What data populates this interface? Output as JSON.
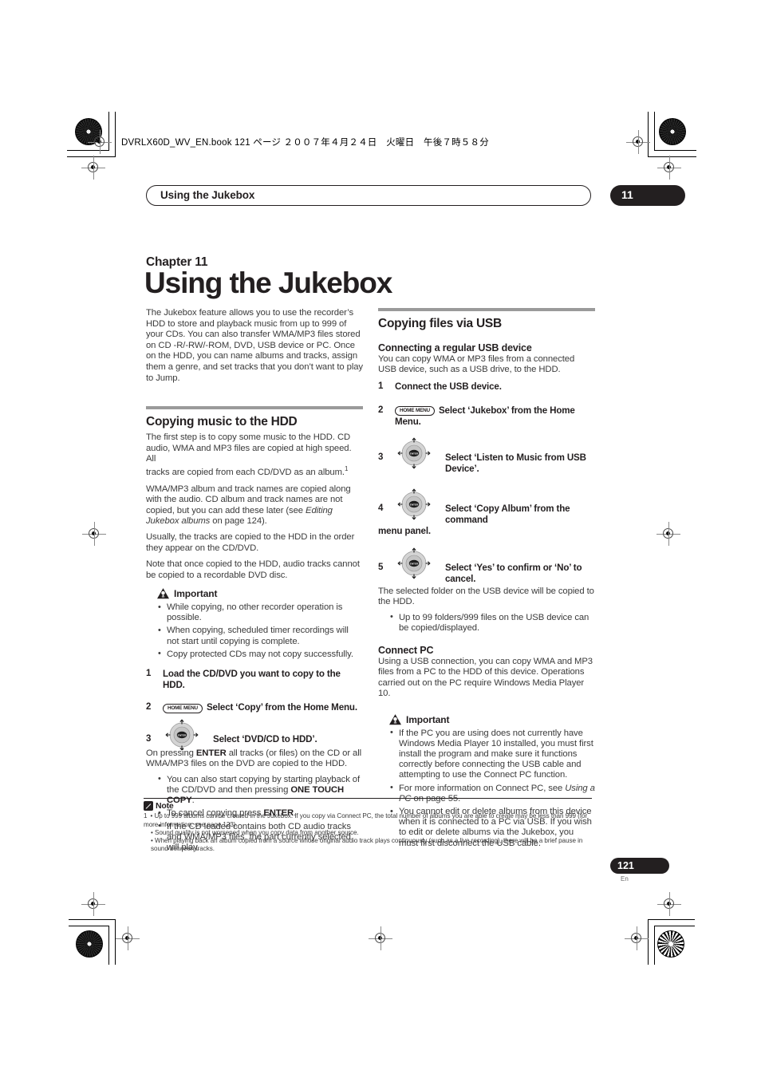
{
  "print_marks": {
    "book_line": "DVRLX60D_WV_EN.book  121 ページ  ２００７年４月２４日　火曜日　午後７時５８分"
  },
  "running_head": {
    "title": "Using the Jukebox",
    "chapter_tab": "11"
  },
  "title_block": {
    "chapter_label": "Chapter 11",
    "chapter_title": "Using the Jukebox",
    "intro": "The Jukebox feature allows you to use the recorder’s HDD to store and playback music from up to 999 of your CDs. You can also transfer WMA/MP3 files stored on CD -R/-RW/-ROM, DVD, USB device or PC. Once on the HDD, you can name albums and tracks, assign them a genre, and set tracks that you don’t want to play to Jump."
  },
  "left_column": {
    "section_heading": "Copying music to the HDD",
    "para_1a": "The first step is to copy some music to the HDD. CD audio, WMA and MP3 files are copied at high speed. All",
    "para_1b": "tracks are copied from each CD/DVD as an album.",
    "footnote_marker": "1",
    "para_2_pre": "WMA/MP3 album and track names are copied along with the audio. CD album and track names are not copied, but you can add these later (see ",
    "para_2_italic": "Editing Jukebox albums",
    "para_2_post": " on page 124).",
    "para_3": "Usually, the tracks are copied to the HDD in the order they appear on the CD/DVD.",
    "para_4": "Note that once copied to the HDD, audio tracks cannot be copied to a recordable DVD disc.",
    "important_label": "Important",
    "important_bullets": [
      "While copying, no other recorder operation is possible.",
      "When copying, scheduled timer recordings will not start until copying is complete.",
      "Copy protected CDs may not copy successfully."
    ],
    "steps": [
      {
        "num": "1",
        "text": "Load the CD/DVD you want to copy to the HDD.",
        "icon": "none"
      },
      {
        "num": "2",
        "button_label": "HOME MENU",
        "text": "Select ‘Copy’ from the Home Menu.",
        "icon": "home-menu-button"
      },
      {
        "num": "3",
        "text": "Select ‘DVD/CD to HDD’.",
        "icon": "navigation-wheel"
      }
    ],
    "step3_body_pre": "On pressing ",
    "step3_body_bold": "ENTER",
    "step3_body_post": " all tracks (or files) on the CD or all WMA/MP3 files on the DVD are copied to the HDD.",
    "step3_bullets": [
      {
        "pre": "You can also start copying by starting playback of the CD/DVD and then pressing ",
        "bold": "ONE TOUCH COPY",
        "post": "."
      },
      {
        "pre": "To cancel copying press ",
        "bold": "ENTER",
        "post": "."
      },
      {
        "pre": "If the CD loaded contains both CD audio tracks and WMA/MP3 files, the part currently selected will play.",
        "bold": "",
        "post": ""
      }
    ]
  },
  "right_column": {
    "section_heading": "Copying files via USB",
    "sub_heading_1": "Connecting a regular USB device",
    "sub_1_body": "You can copy WMA or MP3 files from a connected USB device, such as a USB drive, to the HDD.",
    "steps": [
      {
        "num": "1",
        "text": "Connect the USB device.",
        "icon": "none"
      },
      {
        "num": "2",
        "button_label": "HOME MENU",
        "text": "Select ‘Jukebox’ from the Home Menu.",
        "icon": "home-menu-button"
      },
      {
        "num": "3",
        "text": "Select ‘Listen to Music from USB Device’.",
        "icon": "navigation-wheel"
      },
      {
        "num": "4",
        "text": "Select ‘Copy Album’ from the command",
        "text_cont": "menu panel.",
        "icon": "navigation-wheel"
      },
      {
        "num": "5",
        "text": "Select ‘Yes’ to confirm or ‘No’ to cancel.",
        "icon": "navigation-wheel"
      }
    ],
    "step5_body": "The selected folder on the USB device will be copied to the HDD.",
    "step5_bullets": [
      "Up to 99 folders/999 files on the USB device can be copied/displayed."
    ],
    "sub_heading_2": "Connect PC",
    "sub_2_body": "Using a USB connection, you can copy WMA and MP3 files from a PC to the HDD of this device. Operations carried out on the PC require Windows Media Player 10.",
    "important_label": "Important",
    "important_bullets": [
      {
        "pre": "If the PC you are using does not currently have Windows Media Player 10 installed, you must first install the program and make sure it functions correctly before connecting the USB cable and attempting to use the Connect PC function.",
        "italic": "",
        "post": ""
      },
      {
        "pre": "For more information on Connect PC, see ",
        "italic": "Using a PC",
        "post": " on page 55."
      },
      {
        "pre": "You cannot edit or delete albums from this device when it is connected to a PC via USB. If you wish to edit or delete albums via the Jukebox, you must first disconnect the USB cable.",
        "italic": "",
        "post": ""
      }
    ]
  },
  "footnotes": {
    "label": "Note",
    "marker": "1",
    "items": [
      "Up to 999 albums can be created in the Jukebox. If you copy via Connect PC, the total number of albums you are able to create may be less than 999 (for more information, see page 123).",
      "Sound quality is not worsened when you copy data from another source.",
      "When playing back an album copied from a source whose original audio track plays continuously (such as a live recording), there will be a brief pause in sound between tracks."
    ]
  },
  "footer": {
    "page_number": "121",
    "language": "En"
  },
  "colors": {
    "ink": "#231f20",
    "body_text": "#3b3b3b",
    "rule": "#9a9a9a"
  }
}
